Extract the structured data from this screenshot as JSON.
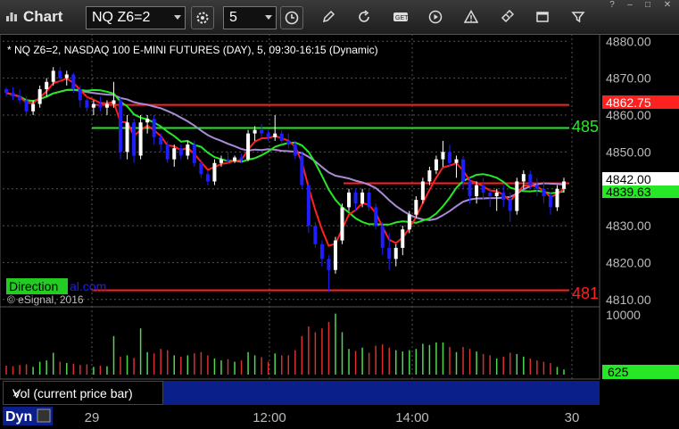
{
  "window": {
    "title": "Chart",
    "symbol": "NQ Z6=2",
    "interval": "5"
  },
  "header_text": "* NQ Z6=2, NASDAQ 100 E-MINI FUTURES (DAY), 5, 09:30-16:15 (Dynamic)",
  "watermark": {
    "brand_a": "Direction",
    "brand_b": "al.com",
    "copyright": "© eSignal, 2016"
  },
  "price_labels": {
    "upper_level": "4862.75",
    "last_price": "4842.00",
    "ma_value": "4839.63",
    "green_line_label": "485",
    "red_line_label": "481"
  },
  "volume": {
    "axis_top": "10000",
    "last": "625",
    "legend": "Vol (current price bar)",
    "close": "×"
  },
  "footer": {
    "mode": "Dyn",
    "x_labels": [
      "29",
      "12:00",
      "14:00",
      "30"
    ]
  },
  "colors": {
    "up": "#ffffff",
    "down": "#1e1eff",
    "red_line": "#ff2020",
    "green_line": "#26e826",
    "purple_ma": "#a98ad6"
  },
  "chart_data": {
    "type": "candlestick",
    "y_ticks": [
      4810,
      4820,
      4830,
      4840,
      4850,
      4860,
      4870,
      4880
    ],
    "ylim": [
      4808.5,
      4882
    ],
    "levels": [
      {
        "price": 4862.75,
        "color": "red"
      },
      {
        "price": 4856.5,
        "color": "green"
      },
      {
        "price": 4812.5,
        "color": "red"
      },
      {
        "price": 4841.5,
        "color": "red"
      }
    ],
    "candles": [
      [
        4867,
        4867.5,
        4865,
        4866
      ],
      [
        4866,
        4867.5,
        4864,
        4865
      ],
      [
        4865,
        4867,
        4863,
        4864
      ],
      [
        4864,
        4865,
        4860,
        4861
      ],
      [
        4861,
        4864,
        4860,
        4863
      ],
      [
        4863,
        4868,
        4862,
        4867
      ],
      [
        4867,
        4870,
        4865,
        4869
      ],
      [
        4869,
        4873,
        4868,
        4872
      ],
      [
        4872,
        4873,
        4869,
        4870
      ],
      [
        4870,
        4872,
        4868,
        4871
      ],
      [
        4871,
        4871.5,
        4866,
        4867
      ],
      [
        4867,
        4868,
        4862,
        4864
      ],
      [
        4864,
        4865,
        4861,
        4862
      ],
      [
        4862,
        4864,
        4860,
        4863
      ],
      [
        4863,
        4865,
        4861,
        4862
      ],
      [
        4862,
        4864,
        4860,
        4863
      ],
      [
        4863,
        4869,
        4862,
        4864
      ],
      [
        4864,
        4865,
        4848,
        4850
      ],
      [
        4850,
        4860,
        4848,
        4858
      ],
      [
        4858,
        4859,
        4847,
        4849
      ],
      [
        4849,
        4860,
        4848,
        4858
      ],
      [
        4858,
        4860,
        4855,
        4859
      ],
      [
        4859,
        4860,
        4852,
        4854
      ],
      [
        4854,
        4855,
        4850,
        4852
      ],
      [
        4852,
        4853,
        4847,
        4848
      ],
      [
        4848,
        4852,
        4846,
        4851
      ],
      [
        4851,
        4852,
        4848,
        4849
      ],
      [
        4849,
        4853,
        4848,
        4852
      ],
      [
        4852,
        4853,
        4846,
        4847
      ],
      [
        4847,
        4848,
        4843,
        4844
      ],
      [
        4844,
        4845,
        4841,
        4842
      ],
      [
        4842,
        4848,
        4841,
        4847
      ],
      [
        4847,
        4849,
        4846,
        4848
      ],
      [
        4848,
        4850,
        4847,
        4847.5
      ],
      [
        4847.5,
        4849,
        4847,
        4848.5
      ],
      [
        4848.5,
        4849.5,
        4847,
        4848
      ],
      [
        4848,
        4856,
        4847.5,
        4855
      ],
      [
        4855,
        4857,
        4853,
        4856
      ],
      [
        4856,
        4857.5,
        4854,
        4855
      ],
      [
        4855,
        4856,
        4853,
        4854
      ],
      [
        4854,
        4860,
        4853,
        4855
      ],
      [
        4855,
        4856,
        4852,
        4853
      ],
      [
        4853,
        4855,
        4851,
        4852
      ],
      [
        4852,
        4853,
        4848,
        4849
      ],
      [
        4849,
        4850,
        4840,
        4841
      ],
      [
        4841,
        4842,
        4828,
        4830
      ],
      [
        4830,
        4831,
        4824,
        4825
      ],
      [
        4825,
        4826,
        4819,
        4821
      ],
      [
        4821,
        4822,
        4812,
        4818
      ],
      [
        4818,
        4827,
        4817,
        4826
      ],
      [
        4826,
        4836,
        4825,
        4835
      ],
      [
        4835,
        4840,
        4834,
        4839
      ],
      [
        4839,
        4840,
        4834,
        4836
      ],
      [
        4836,
        4840,
        4835,
        4839
      ],
      [
        4839,
        4840,
        4834,
        4835
      ],
      [
        4835,
        4836,
        4829,
        4830
      ],
      [
        4830,
        4831,
        4822,
        4824
      ],
      [
        4824,
        4828,
        4818,
        4821
      ],
      [
        4821,
        4825,
        4819,
        4824
      ],
      [
        4824,
        4830,
        4822,
        4829
      ],
      [
        4829,
        4834,
        4828,
        4833
      ],
      [
        4833,
        4838,
        4832,
        4837
      ],
      [
        4837,
        4843,
        4836,
        4842
      ],
      [
        4842,
        4846,
        4841,
        4845
      ],
      [
        4845,
        4849,
        4844,
        4848
      ],
      [
        4848,
        4853,
        4846,
        4850
      ],
      [
        4850,
        4852,
        4846,
        4847
      ],
      [
        4847,
        4849,
        4843,
        4848
      ],
      [
        4848,
        4849,
        4840,
        4842
      ],
      [
        4842,
        4843,
        4836,
        4838
      ],
      [
        4838,
        4842,
        4836,
        4841
      ],
      [
        4841,
        4843,
        4837,
        4839
      ],
      [
        4839,
        4840,
        4835,
        4838
      ],
      [
        4838,
        4840,
        4834,
        4839
      ],
      [
        4839,
        4841,
        4835,
        4837
      ],
      [
        4837,
        4839,
        4831,
        4834
      ],
      [
        4834,
        4843,
        4833,
        4842
      ],
      [
        4842,
        4845,
        4840,
        4844
      ],
      [
        4844,
        4845,
        4840,
        4841
      ],
      [
        4841,
        4843,
        4838,
        4840
      ],
      [
        4840,
        4842,
        4836,
        4838
      ],
      [
        4838,
        4839,
        4833,
        4835
      ],
      [
        4835,
        4841,
        4834,
        4840
      ],
      [
        4840,
        4843,
        4839,
        4842
      ]
    ],
    "volumes": [
      0.14,
      0.13,
      0.15,
      0.16,
      0.12,
      0.2,
      0.22,
      0.34,
      0.2,
      0.18,
      0.17,
      0.15,
      0.16,
      0.12,
      0.14,
      0.13,
      0.6,
      0.28,
      0.3,
      0.26,
      0.72,
      0.35,
      0.33,
      0.4,
      0.38,
      0.3,
      0.28,
      0.3,
      0.33,
      0.35,
      0.3,
      0.25,
      0.22,
      0.24,
      0.2,
      0.22,
      0.35,
      0.3,
      0.27,
      0.2,
      0.33,
      0.3,
      0.3,
      0.38,
      0.6,
      0.75,
      0.66,
      0.72,
      0.82,
      0.95,
      0.66,
      0.4,
      0.37,
      0.42,
      0.34,
      0.45,
      0.47,
      0.42,
      0.38,
      0.36,
      0.38,
      0.4,
      0.48,
      0.46,
      0.5,
      0.5,
      0.43,
      0.35,
      0.43,
      0.4,
      0.36,
      0.32,
      0.3,
      0.25,
      0.28,
      0.34,
      0.32,
      0.28,
      0.25,
      0.22,
      0.2,
      0.18,
      0.12,
      0.08
    ]
  }
}
